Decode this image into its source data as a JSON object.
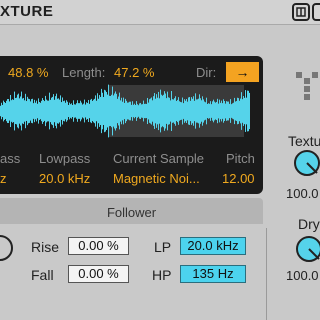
{
  "device": {
    "title": "XTURE",
    "header_icons": [
      "fold-icon",
      "power-icon"
    ]
  },
  "display": {
    "top_row": {
      "value1": "48.8 %",
      "length_label": "Length:",
      "length_value": "47.2 %",
      "dir_label": "Dir:",
      "dir_button": "→"
    },
    "params": {
      "labels": [
        "ass",
        "Lowpass",
        "Current Sample",
        "Pitch"
      ],
      "values": [
        "z",
        "20.0 kHz",
        "Magnetic Noi...",
        "12.00"
      ]
    }
  },
  "follower": {
    "title": "Follower",
    "rise_label": "Rise",
    "rise_value": "0.00 %",
    "fall_label": "Fall",
    "fall_value": "0.00 %",
    "lp_label": "LP",
    "lp_value": "20.0 kHz",
    "hp_label": "HP",
    "hp_value": "135 Hz"
  },
  "side": {
    "texture_label": "Textu",
    "texture_value": "100.0",
    "dry_label": "Dry",
    "dry_value": "100.0"
  },
  "colors": {
    "accent_orange": "#f4a321",
    "waveform": "#55d3ea",
    "field_cyan": "#4cd3ee"
  }
}
